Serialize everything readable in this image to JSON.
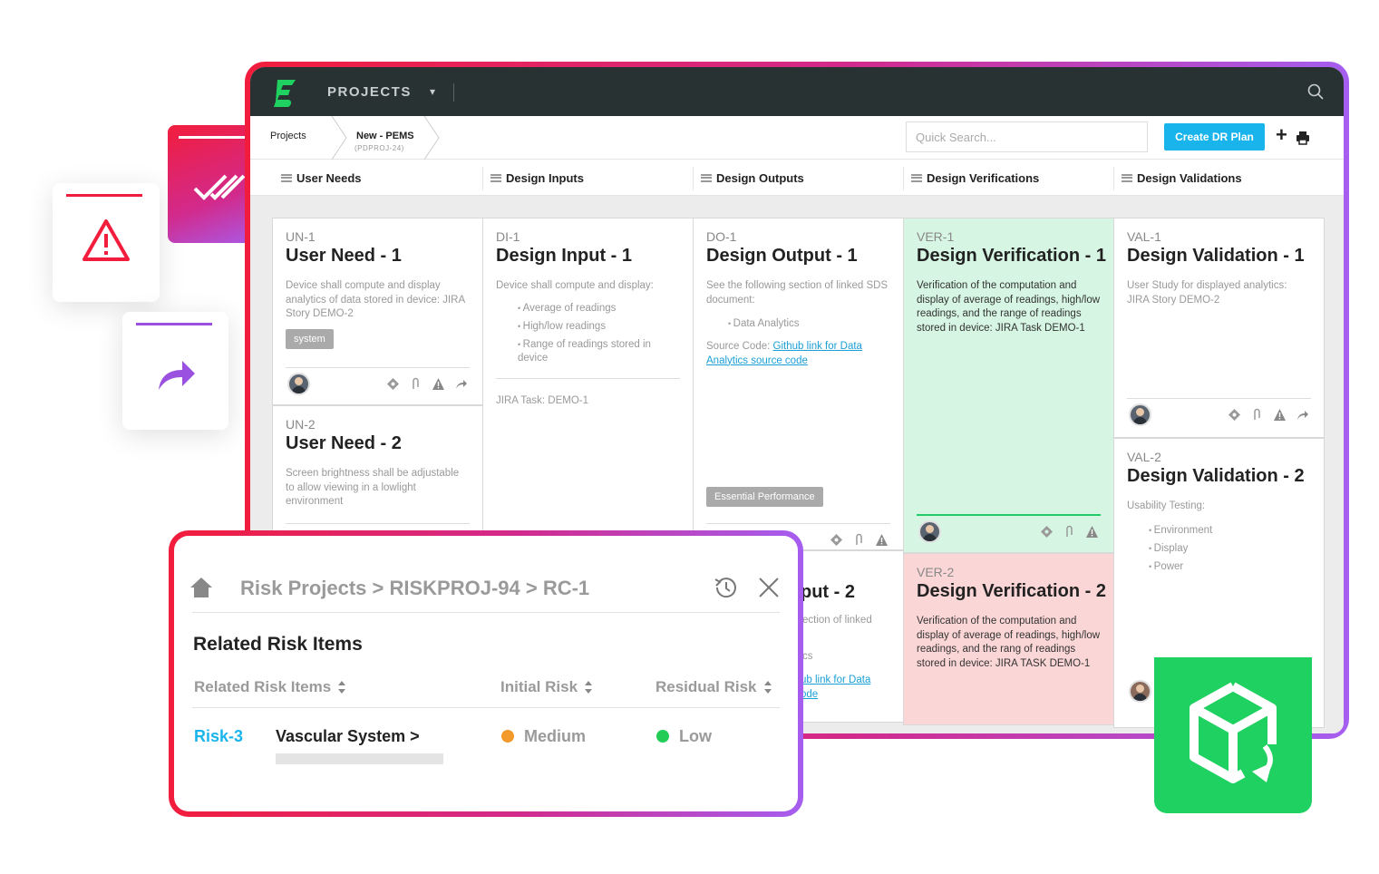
{
  "topbar": {
    "title": "PROJECTS",
    "chevron": "⌄"
  },
  "breadcrumb": {
    "root": "Projects",
    "project_name": "New - PEMS",
    "project_code": "(PDPROJ-24)"
  },
  "search": {
    "placeholder": "Quick Search..."
  },
  "toolbar": {
    "create_label": "Create DR Plan",
    "plus": "+"
  },
  "columns": [
    "User Needs",
    "Design Inputs",
    "Design Outputs",
    "Design Verifications",
    "Design Validations"
  ],
  "cards": {
    "un1": {
      "id": "UN-1",
      "title": "User Need - 1",
      "desc": "Device shall compute and display analytics of data stored in device: JIRA Story DEMO-2",
      "tag": "system"
    },
    "un2": {
      "id": "UN-2",
      "title": "User Need - 2",
      "desc": "Screen brightness shall be adjustable to allow viewing in a lowlight environment"
    },
    "di1": {
      "id": "DI-1",
      "title": "Design Input - 1",
      "desc": "Device shall compute and display:",
      "bullets": [
        "Average of readings",
        "High/low readings",
        "Range of readings stored in device"
      ],
      "task": "JIRA Task: DEMO-1"
    },
    "do1": {
      "id": "DO-1",
      "title": "Design Output - 1",
      "desc": "See the following section of linked SDS document:",
      "bullets": [
        "Data Analytics"
      ],
      "source_prefix": "Source Code: ",
      "source_link": "Github link for Data Analytics source code",
      "tag": "Essential Performance"
    },
    "do2": {
      "title_partial": "put - 2",
      "desc_partial": "ection of linked",
      "bullet_partial": "cs",
      "link_partial_1": "ub link for Data",
      "link_partial_2": "ode"
    },
    "ver1": {
      "id": "VER-1",
      "title": "Design Verification - 1",
      "desc": "Verification of the computation and display of average of readings, high/low readings, and the range of readings stored in device: JIRA Task DEMO-1"
    },
    "ver2": {
      "id": "VER-2",
      "title": "Design Verification - 2",
      "desc": "Verification of the computation and display of average of readings, high/low readings, and the rang of readings stored in device: JIRA TASK DEMO-1"
    },
    "val1": {
      "id": "VAL-1",
      "title": "Design Validation - 1",
      "desc": "User Study for displayed analytics: JIRA Story DEMO-2"
    },
    "val2": {
      "id": "VAL-2",
      "title": "Design Validation - 2",
      "desc": "Usability Testing:",
      "bullets": [
        "Environment",
        "Display",
        "Power"
      ]
    }
  },
  "risk_panel": {
    "breadcrumb": "Risk Projects > RISKPROJ-94 > RC-1",
    "title": "Related Risk Items",
    "headers": [
      "Related Risk Items",
      "Initial Risk",
      "Residual Risk"
    ],
    "rows": [
      {
        "id": "Risk-3",
        "name": "Vascular System >",
        "initial": "Medium",
        "residual": "Low"
      }
    ]
  },
  "colors": {
    "brand_green": "#1ed160",
    "accent_blue": "#1ab4ec",
    "medium": "#f39a2c",
    "low": "#22cc55",
    "verification_bg": "#d6f5e2",
    "failed_bg": "#fbd6d6"
  },
  "icons": [
    "alert-triangle-icon",
    "double-check-icon",
    "share-arrow-icon",
    "search-icon",
    "print-icon",
    "home-icon",
    "history-icon",
    "close-icon",
    "diamond-icon",
    "paperclip-icon",
    "warning-icon",
    "arrow-icon",
    "box-icon"
  ]
}
